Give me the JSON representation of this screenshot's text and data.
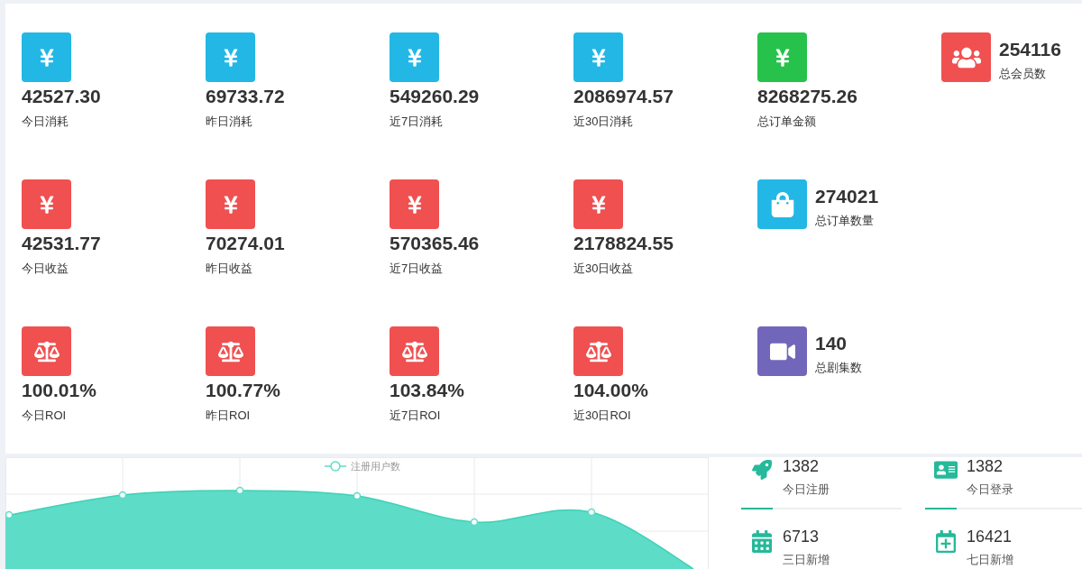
{
  "stat_rows": [
    {
      "items": [
        {
          "kind": "spend",
          "value": "42527.30",
          "label": "今日消耗"
        },
        {
          "kind": "spend",
          "value": "69733.72",
          "label": "昨日消耗"
        },
        {
          "kind": "spend",
          "value": "549260.29",
          "label": "近7日消耗"
        },
        {
          "kind": "spend",
          "value": "2086974.57",
          "label": "近30日消耗"
        },
        {
          "kind": "order_amount",
          "value": "8268275.26",
          "label": "总订单金额"
        },
        {
          "kind": "members",
          "value": "254116",
          "label": "总会员数"
        }
      ]
    },
    {
      "items": [
        {
          "kind": "income",
          "value": "42531.77",
          "label": "今日收益"
        },
        {
          "kind": "income",
          "value": "70274.01",
          "label": "昨日收益"
        },
        {
          "kind": "income",
          "value": "570365.46",
          "label": "近7日收益"
        },
        {
          "kind": "income",
          "value": "2178824.55",
          "label": "近30日收益"
        },
        {
          "kind": "order_count",
          "value": "274021",
          "label": "总订单数量"
        }
      ]
    },
    {
      "items": [
        {
          "kind": "roi",
          "value": "100.01%",
          "label": "今日ROI"
        },
        {
          "kind": "roi",
          "value": "100.77%",
          "label": "昨日ROI"
        },
        {
          "kind": "roi",
          "value": "103.84%",
          "label": "近7日ROI"
        },
        {
          "kind": "roi",
          "value": "104.00%",
          "label": "近30日ROI"
        },
        {
          "kind": "episodes",
          "value": "140",
          "label": "总剧集数"
        }
      ]
    }
  ],
  "registration_chart": {
    "legend": "注册用户数"
  },
  "user_stats": [
    {
      "value": "1382",
      "label": "今日注册"
    },
    {
      "value": "1382",
      "label": "今日登录"
    },
    {
      "value": "6713",
      "label": "三日新增"
    },
    {
      "value": "16421",
      "label": "七日新增"
    }
  ]
}
